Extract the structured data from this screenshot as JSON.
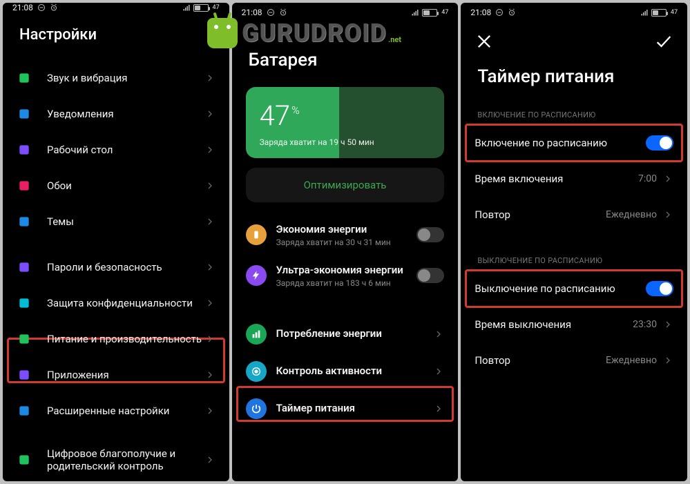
{
  "status": {
    "time": "21:08",
    "battery": "47"
  },
  "watermark": {
    "brand": "GURUDROID",
    "tld": ".net"
  },
  "panel1": {
    "title": "Настройки",
    "rows": [
      {
        "label": "Звук и вибрация",
        "icon": "sound-icon",
        "color": "#20c25c"
      },
      {
        "label": "Уведомления",
        "icon": "notifications-icon",
        "color": "#1e88e5"
      },
      {
        "label": "Рабочий стол",
        "icon": "home-icon",
        "color": "#7c4dff"
      },
      {
        "label": "Обои",
        "icon": "wallpaper-icon",
        "color": "#e91e63"
      },
      {
        "label": "Темы",
        "icon": "themes-icon",
        "color": "#1e88e5"
      }
    ],
    "rows2": [
      {
        "label": "Пароли и безопасность",
        "icon": "security-icon",
        "color": "#7c4dff"
      },
      {
        "label": "Защита конфиденциальности",
        "icon": "privacy-icon",
        "color": "#00bcd4"
      },
      {
        "label": "Питание и производительность",
        "icon": "battery-icon",
        "color": "#20c25c"
      },
      {
        "label": "Приложения",
        "icon": "apps-icon",
        "color": "#7c4dff"
      },
      {
        "label": "Расширенные настройки",
        "icon": "more-icon",
        "color": "#1e88e5"
      }
    ],
    "rows3": [
      {
        "label": "Цифровое благополучие и родительский контроль",
        "icon": "wellbeing-icon",
        "color": "#20c25c"
      }
    ]
  },
  "panel2": {
    "title": "Батарея",
    "card": {
      "pct": "47",
      "symbol": "%",
      "sub": "Заряда хватит на 19 ч 50 мин"
    },
    "optimize": "Оптимизировать",
    "rowsA": [
      {
        "label": "Экономия энергии",
        "sub": "Заряда хватит на 30 ч 31 мин",
        "color": "#e8a13a"
      },
      {
        "label": "Ультра-экономия энергии",
        "sub": "Заряда хватит на 183 ч 6 мин",
        "color": "#8a4af0"
      }
    ],
    "rowsB": [
      {
        "label": "Потребление энергии",
        "color": "#19a657"
      },
      {
        "label": "Контроль активности",
        "color": "#16a7c7"
      },
      {
        "label": "Таймер питания",
        "color": "#1f74e0"
      }
    ]
  },
  "panel3": {
    "title": "Таймер питания",
    "sectionOn": "ВКЛЮЧЕНИЕ ПО РАСПИСАНИЮ",
    "on_toggle_label": "Включение по расписанию",
    "on_time_label": "Время включения",
    "on_time_value": "7:00",
    "on_repeat_label": "Повтор",
    "on_repeat_value": "Ежедневно",
    "sectionOff": "ВЫКЛЮЧЕНИЕ ПО РАСПИСАНИЮ",
    "off_toggle_label": "Выключение по расписанию",
    "off_time_label": "Время выключения",
    "off_time_value": "23:30",
    "off_repeat_label": "Повтор",
    "off_repeat_value": "Ежедневно"
  }
}
